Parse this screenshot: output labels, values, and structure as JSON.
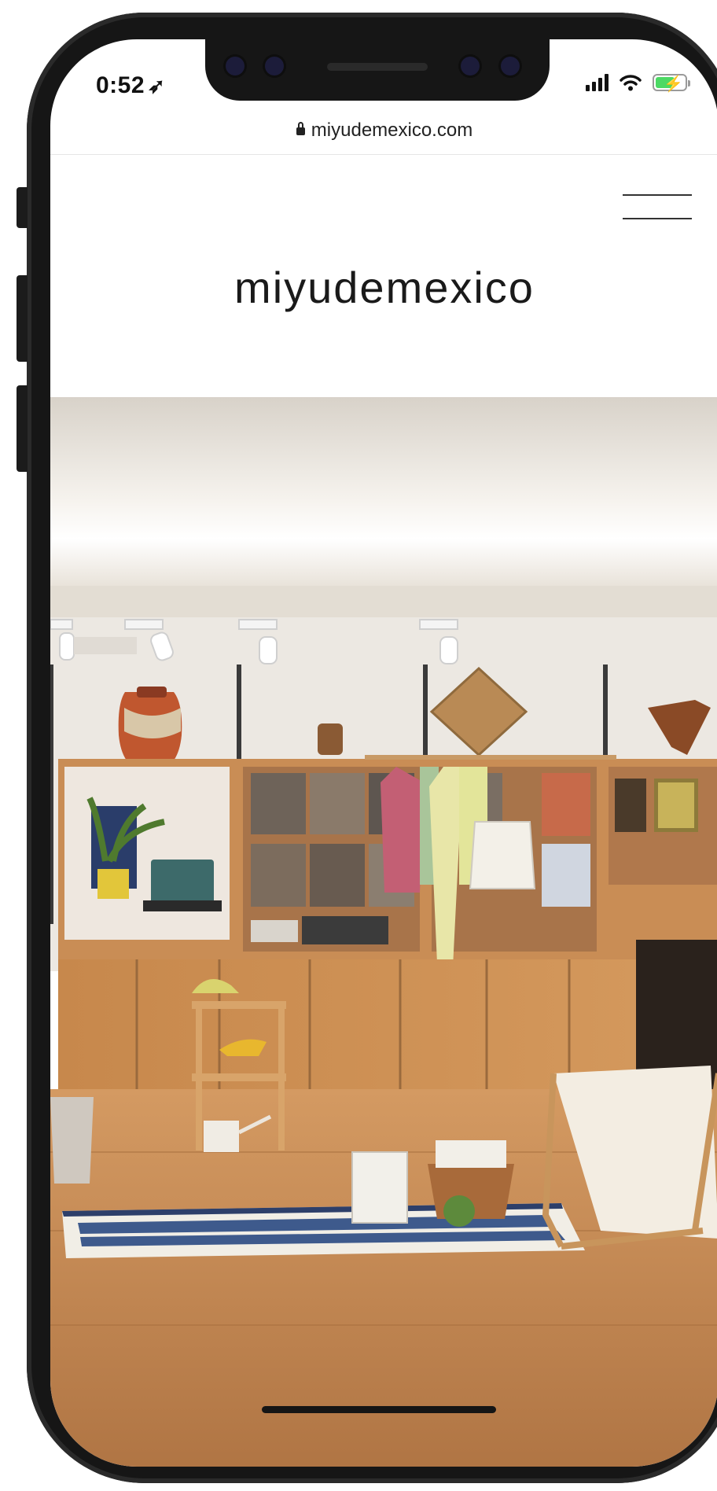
{
  "status_bar": {
    "time": "0:52",
    "location_icon": "location-arrow-icon",
    "signal_icon": "cellular-signal-icon",
    "wifi_icon": "wifi-icon",
    "battery_icon": "battery-charging-icon",
    "battery_color": "#4cd964"
  },
  "browser": {
    "url": "miyudemexico.com",
    "lock_icon": "lock-icon"
  },
  "site": {
    "brand": "miyudemexico",
    "menu_icon": "hamburger-menu-icon",
    "hero_image": "shop-interior-photo"
  },
  "colors": {
    "frame": "#161616",
    "wood": "#c98d55",
    "wall": "#ece8e2"
  }
}
